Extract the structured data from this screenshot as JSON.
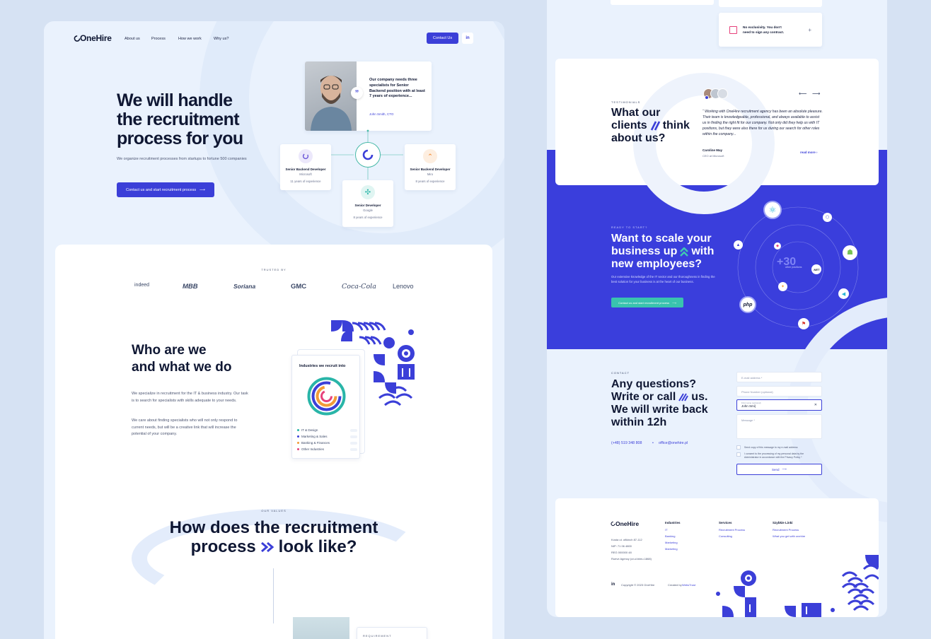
{
  "left": {
    "nav": {
      "logo": "OneHire",
      "links": [
        "About us",
        "Process",
        "How we work",
        "Why us?"
      ],
      "contact_button": "Contact Us",
      "linkedin": "in"
    },
    "hero": {
      "title_lines": [
        "We will handle",
        "the recruitment",
        "process for you"
      ],
      "subtitle": "We organize recruitment processes from startups to fortune 500 companies",
      "cta": "Contact us and start recruitment process"
    },
    "quote_card": {
      "text": "Our company needs three specialists for Senior Backend position with at least 7 years of experience...",
      "author": "John Smith, CTO"
    },
    "position_cards": [
      {
        "title": "Senior Backend Developer",
        "company": "Microsoft",
        "experience": "11 years of experience"
      },
      {
        "title": "Senior Backend Developer",
        "company": "Miro",
        "experience": "8 years of experience"
      },
      {
        "title": "Senior Developer",
        "company": "Google",
        "experience": "8 years of experience"
      }
    ],
    "trusted": {
      "label": "TRUSTED BY",
      "logos": [
        "indeed",
        "MBB",
        "Soriana",
        "GMC",
        "Coca-Cola",
        "Lenovo"
      ]
    },
    "who": {
      "title_lines": [
        "Who are we",
        "and what we do"
      ],
      "p1": "We specialize in recruitment for the IT & business industry. Our task is to search for specialists with skills adequate to your needs.",
      "p2": "We care about finding specialists who will not only respond to current needs, but will be a creative link that will increase the potential of your company."
    },
    "industries": {
      "title": "Industries we recruit into",
      "items": [
        {
          "label": "IT & Design",
          "color": "#29b5a8"
        },
        {
          "label": "Marketing & Sales",
          "color": "#3b3fd8"
        },
        {
          "label": "Banking & Finances",
          "color": "#f29b38"
        },
        {
          "label": "Other Industries",
          "color": "#e6407a"
        }
      ]
    },
    "values": {
      "label": "OUR VALUES",
      "title_line1": "How does the recruitment",
      "title_line2a": "process",
      "title_line2b": "look like?",
      "req_label": "REQUIREMENT"
    }
  },
  "right": {
    "faq_text": "No exclusivity. You don't need to sign any contract.",
    "faq_plus": "+",
    "testimonials": {
      "label": "TESTIMONIALS",
      "title_l1": "What our",
      "title_l2a": "clients",
      "title_l2b": "think",
      "title_l3": "about us?",
      "quote": "“ Working with OneHire recruitment agency has been an absolute pleasure. Their team is knowledgeable, professional, and always available to assist us in finding the right fit for our company. Not only did they help us with IT positions, but they were also there for us during our search for other roles within the company...",
      "author": "Caroline May",
      "role": "CEO at Microsoft",
      "read_more": "read more",
      "arrow_prev": "⟵",
      "arrow_next": "⟶"
    },
    "scale": {
      "label": "READY TO START?",
      "title_l1": "Want to scale your",
      "title_l2a": "business up",
      "title_l2b": "with",
      "title_l3": "new employees?",
      "text": "Our extensive knowledge of the IT sector and our thoroughness in finding the best solution for your business is at the heart of our business.",
      "cta": "Contact us and start recruitment process",
      "center_big": "+30",
      "center_small": "other positions",
      "php": "php"
    },
    "contact": {
      "label": "CONTACT",
      "title_lines": [
        "Any questions?",
        "Write or call",
        "us.",
        "We will write back",
        "within 12h"
      ],
      "phone": "(+48) 519 348 808",
      "email": "office@onehire.pl",
      "email_field": "E-mail address *",
      "phone_field": "Phone Number (optional)",
      "name_label": "First name (optional)",
      "name_value": "John Smi|",
      "message_field": "Message *",
      "check1": "Send copy of this message to my e-mail address",
      "check2": "I consent to the processing of my personal data by the Administrator in accordance with the Privacy Policy *",
      "send": "Send"
    },
    "footer": {
      "logo": "OneHire",
      "address": [
        "Kosta ut. ofikinch 87-112",
        "NIP: 71 06 4800",
        "REG 000000 48",
        "Rueve Agency (ut.ul.bimu.1868)"
      ],
      "cols": [
        {
          "title": "Industries",
          "items": [
            "IT",
            "Banking",
            "Marketing",
            "Marketing"
          ]
        },
        {
          "title": "Services",
          "items": [
            "Recruitment Process",
            "Consulting"
          ]
        },
        {
          "title": "Szybkie Linki",
          "items": [
            "Recruitment Process",
            "What you get with onehire"
          ]
        }
      ],
      "linkedin": "in",
      "copyright": "Copyright © 2023 OneHire",
      "created_by": "Created by",
      "creator": "WebsTrust"
    }
  }
}
